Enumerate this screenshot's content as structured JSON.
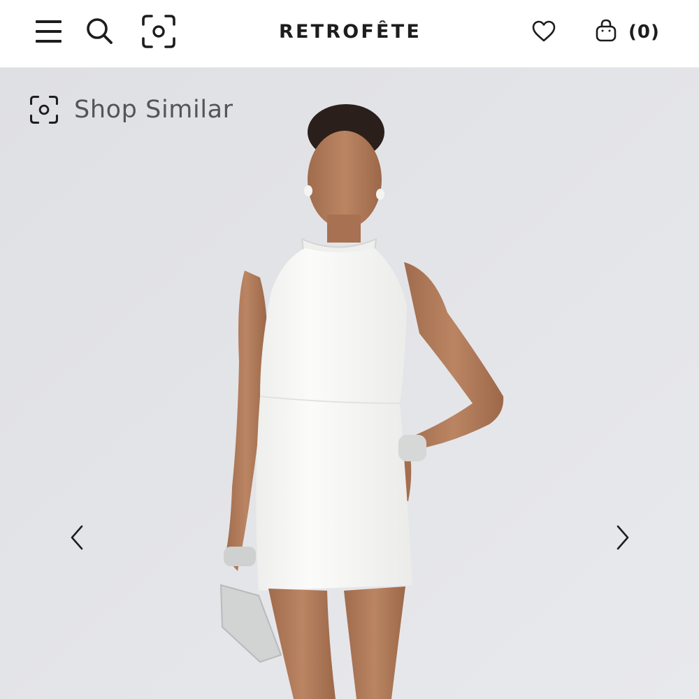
{
  "header": {
    "brand": "RETROFÊTE",
    "cart_count": "(0)",
    "icons": [
      "menu-icon",
      "search-icon",
      "visual-search-icon",
      "heart-icon",
      "shopping-bag-icon"
    ]
  },
  "hero": {
    "shop_similar_label": "Shop Similar",
    "icons": [
      "visual-search-icon",
      "chevron-left-icon",
      "chevron-right-icon"
    ]
  },
  "colors": {
    "header_bg": "#ffffff",
    "text": "#1d1d1d",
    "hero_bg": "#e4e5e8",
    "dress": "#f7f7f5",
    "skin": "#b07a58"
  }
}
